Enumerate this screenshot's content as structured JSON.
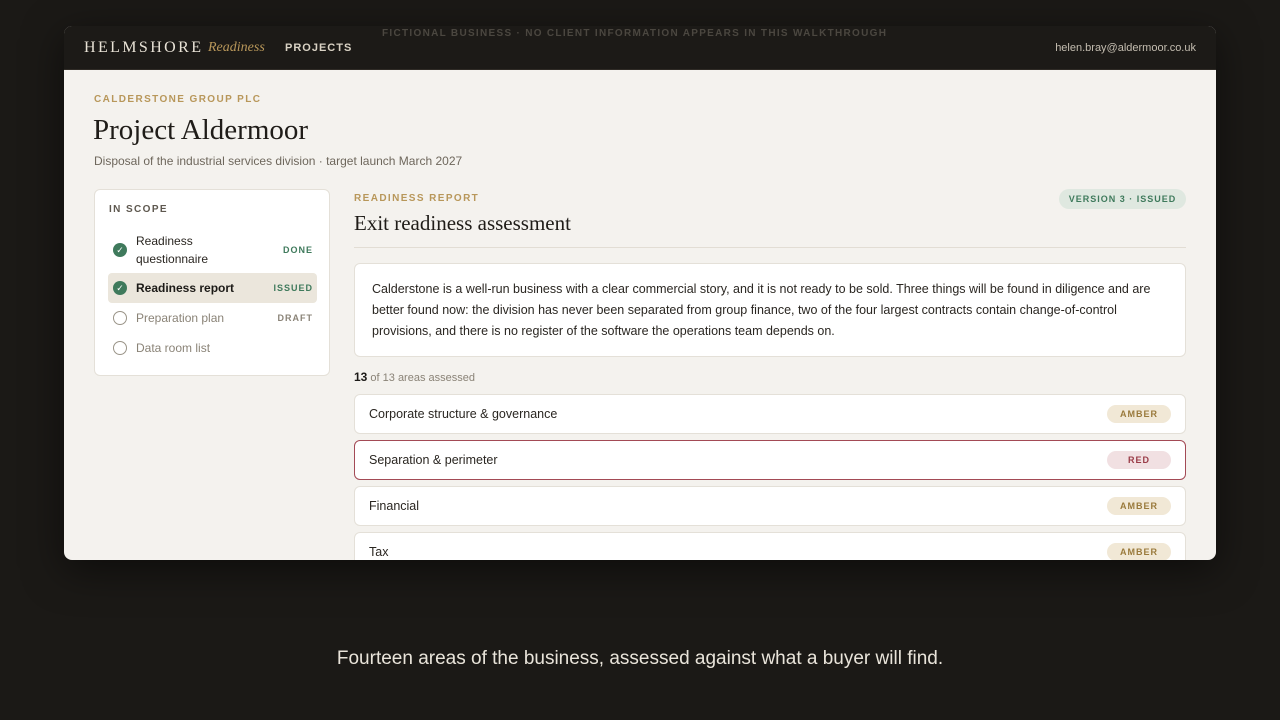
{
  "topbar": {
    "brand": "HELMSHORE",
    "brand_sub": "Readiness",
    "nav_projects": "PROJECTS",
    "notice": "FICTIONAL BUSINESS · NO CLIENT INFORMATION APPEARS IN THIS WALKTHROUGH",
    "user_email": "helen.bray@aldermoor.co.uk"
  },
  "header": {
    "client": "CALDERSTONE GROUP PLC",
    "title": "Project Aldermoor",
    "subtitle": "Disposal of the industrial services division · target launch March 2027"
  },
  "scope": {
    "heading": "IN SCOPE",
    "items": [
      {
        "label": "Readiness questionnaire",
        "status": "DONE",
        "icon": "check-circle-icon"
      },
      {
        "label": "Readiness report",
        "status": "ISSUED",
        "icon": "check-circle-icon"
      },
      {
        "label": "Preparation plan",
        "status": "DRAFT",
        "icon": "empty-circle-icon"
      },
      {
        "label": "Data room list",
        "status": "",
        "icon": "empty-circle-icon"
      }
    ]
  },
  "report": {
    "eyebrow": "READINESS REPORT",
    "version": "VERSION 3 · ISSUED",
    "title": "Exit readiness assessment",
    "summary": "Calderstone is a well-run business with a clear commercial story, and it is not ready to be sold. Three things will be found in diligence and are better found now: the division has never been separated from group finance, two of the four largest contracts contain change-of-control provisions, and there is no register of the software the operations team depends on.",
    "assessed_count": "13",
    "assessed_suffix": "of 13 areas assessed",
    "areas": [
      {
        "name": "Corporate structure & governance",
        "rating": "AMBER"
      },
      {
        "name": "Separation & perimeter",
        "rating": "RED"
      },
      {
        "name": "Financial",
        "rating": "AMBER"
      },
      {
        "name": "Tax",
        "rating": "AMBER"
      }
    ]
  },
  "caption": "Fourteen areas of the business, assessed against what a buyer will find.",
  "colors": {
    "accent_gold": "#b8975a",
    "status_green": "#3f7a5c",
    "amber": "#9a7a3c",
    "red": "#9a3b47"
  }
}
